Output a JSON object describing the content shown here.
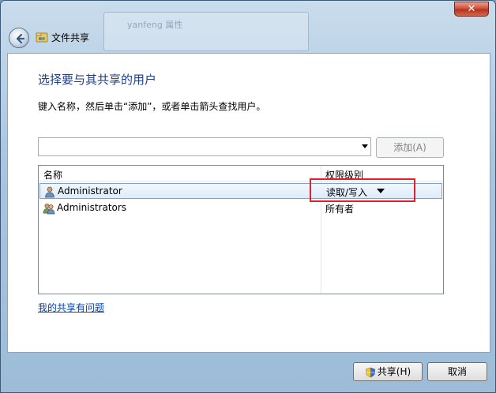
{
  "background_window": {
    "title": "yanfeng 属性"
  },
  "title_bar": {
    "close_label": "✕"
  },
  "header": {
    "title": "文件共享"
  },
  "main": {
    "heading": "选择要与其共享的用户",
    "instruction": "键入名称，然后单击“添加”，或者单击箭头查找用户。",
    "name_input_value": "",
    "add_button": "添加(A)",
    "table": {
      "columns": [
        "名称",
        "权限级别"
      ],
      "rows": [
        {
          "name": "Administrator",
          "permission": "读取/写入",
          "selected": true
        },
        {
          "name": "Administrators",
          "permission": "所有者",
          "selected": false
        }
      ]
    },
    "help_link": "我的共享有问题"
  },
  "footer": {
    "share_button": "共享(H)",
    "cancel_button": "取消"
  },
  "colors": {
    "heading": "#1e3f87",
    "link": "#0645ad",
    "highlight": "#e0202a",
    "selection": "#dcebfc"
  },
  "icons": {
    "back": "back-arrow-icon",
    "title": "share-folder-icon",
    "user": "user-icon",
    "group": "group-users-icon",
    "shield": "uac-shield-icon"
  }
}
